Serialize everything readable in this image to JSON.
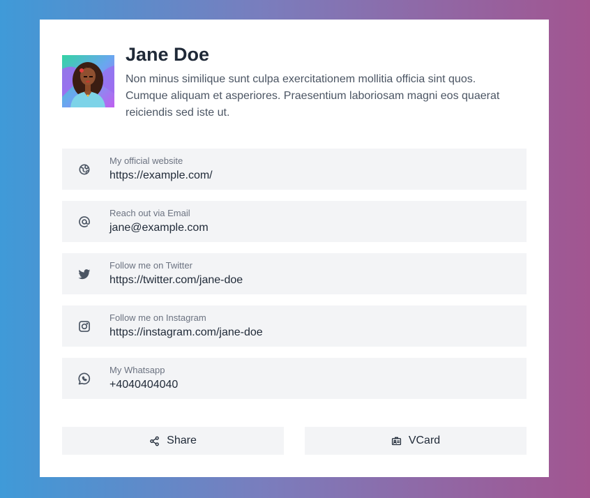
{
  "profile": {
    "name": "Jane Doe",
    "bio": "Non minus similique sunt culpa exercitationem mollitia officia sint quos. Cumque aliquam et asperiores. Praesentium laboriosam magni eos quaerat reiciendis sed iste ut."
  },
  "links": [
    {
      "icon": "globe-icon",
      "label": "My official website",
      "value": "https://example.com/"
    },
    {
      "icon": "at-sign-icon",
      "label": "Reach out via Email",
      "value": "jane@example.com"
    },
    {
      "icon": "twitter-icon",
      "label": "Follow me on Twitter",
      "value": "https://twitter.com/jane-doe"
    },
    {
      "icon": "instagram-icon",
      "label": "Follow me on Instagram",
      "value": "https://instagram.com/jane-doe"
    },
    {
      "icon": "whatsapp-icon",
      "label": "My Whatsapp",
      "value": "+4040404040"
    }
  ],
  "actions": {
    "share_label": "Share",
    "vcard_label": "VCard"
  },
  "colors": {
    "gradient_start": "#3f9ad8",
    "gradient_end": "#a25590",
    "row_background": "#f3f4f6",
    "text_primary": "#1f2937",
    "text_muted": "#6b7280"
  }
}
